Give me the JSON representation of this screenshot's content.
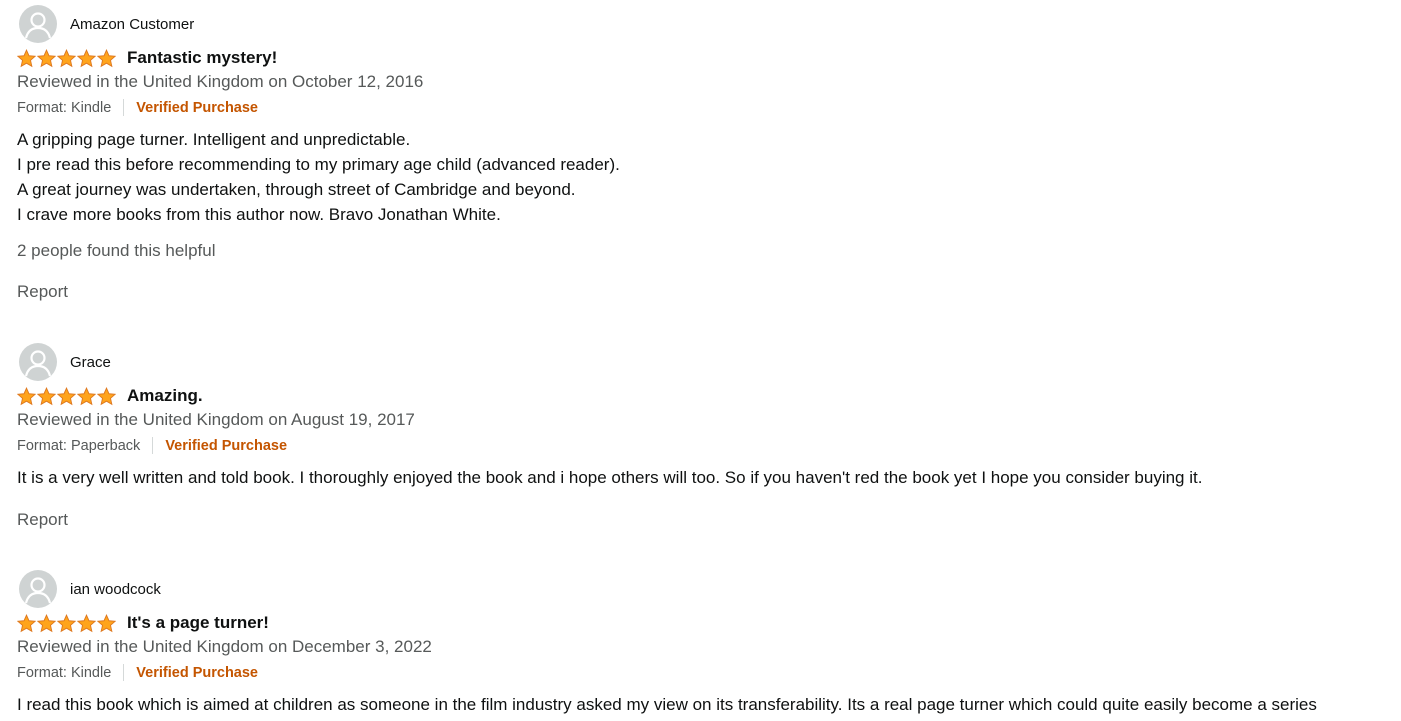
{
  "reviews": [
    {
      "author": "Amazon Customer",
      "rating": 5,
      "rating_max": 5,
      "title": "Fantastic mystery!",
      "date": "Reviewed in the United Kingdom on October 12, 2016",
      "format": "Format: Kindle",
      "verified": "Verified Purchase",
      "body": [
        "A gripping page turner. Intelligent and unpredictable.",
        "I pre read this before recommending to my primary age child (advanced reader).",
        "A great journey was undertaken, through street of Cambridge and beyond.",
        "I crave more books from this author now. Bravo Jonathan White."
      ],
      "helpful": "2 people found this helpful",
      "report": "Report"
    },
    {
      "author": "Grace",
      "rating": 5,
      "rating_max": 5,
      "title": "Amazing.",
      "date": "Reviewed in the United Kingdom on August 19, 2017",
      "format": "Format: Paperback",
      "verified": "Verified Purchase",
      "body": [
        "It is a very well written and told book. I thoroughly enjoyed the book and i hope others will too. So if you haven't red the book yet I hope you consider buying it."
      ],
      "report": "Report"
    },
    {
      "author": "ian woodcock",
      "rating": 5,
      "rating_max": 5,
      "title": "It's a page turner!",
      "date": "Reviewed in the United Kingdom on December 3, 2022",
      "format": "Format: Kindle",
      "verified": "Verified Purchase",
      "body": [
        "I read this book which is aimed at children as someone in the film industry asked my view on its transferability. Its a real page turner which could quite easily become a series"
      ]
    }
  ],
  "colors": {
    "star": "#ffa41c",
    "star_stroke": "#de7921",
    "verified": "#c45500",
    "muted": "#565959",
    "avatar_bg": "#cfd3d3"
  },
  "icons": {
    "avatar": "default-profile-avatar-icon",
    "star": "star-filled-icon"
  }
}
